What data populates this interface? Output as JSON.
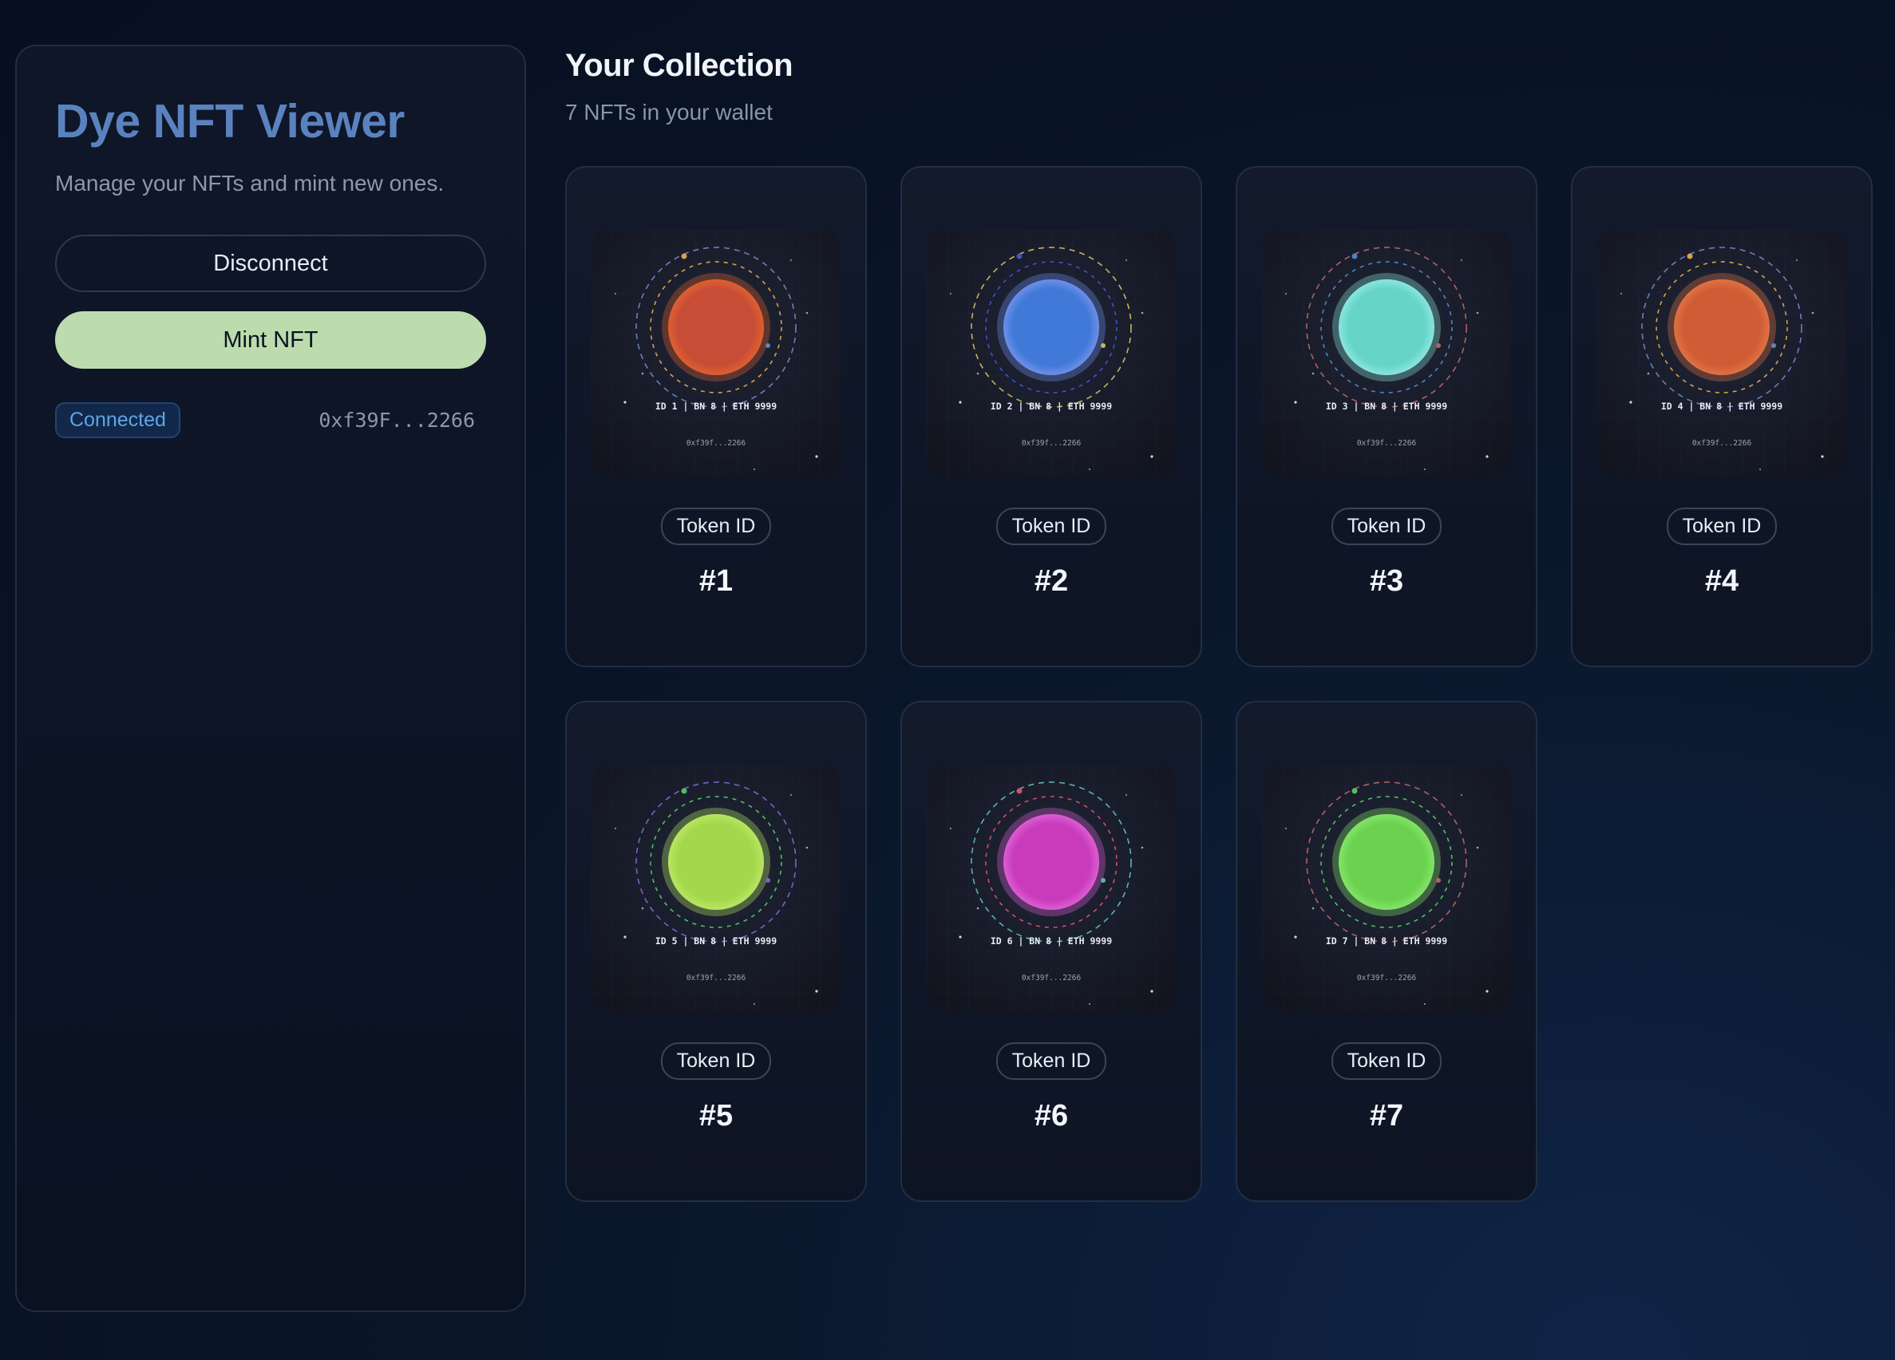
{
  "sidebar": {
    "title": "Dye NFT Viewer",
    "subtitle": "Manage your NFTs and mint new ones.",
    "disconnect_label": "Disconnect",
    "mint_label": "Mint NFT",
    "status": "Connected",
    "wallet_address": "0xf39F...2266"
  },
  "main": {
    "title": "Your Collection",
    "count_text": "7 NFTs in your wallet",
    "token_id_label": "Token ID",
    "nfts": [
      {
        "number": "#1",
        "art_line": "ID 1 | BN 8 | ETH 9999",
        "art_addr": "0xf39f...2266",
        "color": "#c84d36",
        "glow": "#e0602f",
        "ring_inner": "#d8a347",
        "ring_outer": "#6c7fbd"
      },
      {
        "number": "#2",
        "art_line": "ID 2 | BN 8 | ETH 9999",
        "art_addr": "0xf39f...2266",
        "color": "#4179d8",
        "glow": "#6e8fea",
        "ring_inner": "#4a4fc8",
        "ring_outer": "#c9b35a"
      },
      {
        "number": "#3",
        "art_line": "ID 3 | BN 8 | ETH 9999",
        "art_addr": "0xf39f...2266",
        "color": "#66d4c9",
        "glow": "#8ae6dd",
        "ring_inner": "#4e83c6",
        "ring_outer": "#b06262"
      },
      {
        "number": "#4",
        "art_line": "ID 4 | BN 8 | ETH 9999",
        "art_addr": "0xf39f...2266",
        "color": "#cf5c34",
        "glow": "#e07242",
        "ring_inner": "#d8a347",
        "ring_outer": "#6c7fbd"
      },
      {
        "number": "#5",
        "art_line": "ID 5 | BN 8 | ETH 9999",
        "art_addr": "0xf39f...2266",
        "color": "#a5d74c",
        "glow": "#b8e662",
        "ring_inner": "#4fc25c",
        "ring_outer": "#7a64c0"
      },
      {
        "number": "#6",
        "art_line": "ID 6 | BN 8 | ETH 9999",
        "art_addr": "0xf39f...2266",
        "color": "#c93bbb",
        "glow": "#dd5ed3",
        "ring_inner": "#d44d72",
        "ring_outer": "#5fb3a7"
      },
      {
        "number": "#7",
        "art_line": "ID 7 | BN 8 | ETH 9999",
        "art_addr": "0xf39f...2266",
        "color": "#6ad24f",
        "glow": "#83e466",
        "ring_inner": "#4fc25c",
        "ring_outer": "#b06262"
      }
    ]
  }
}
